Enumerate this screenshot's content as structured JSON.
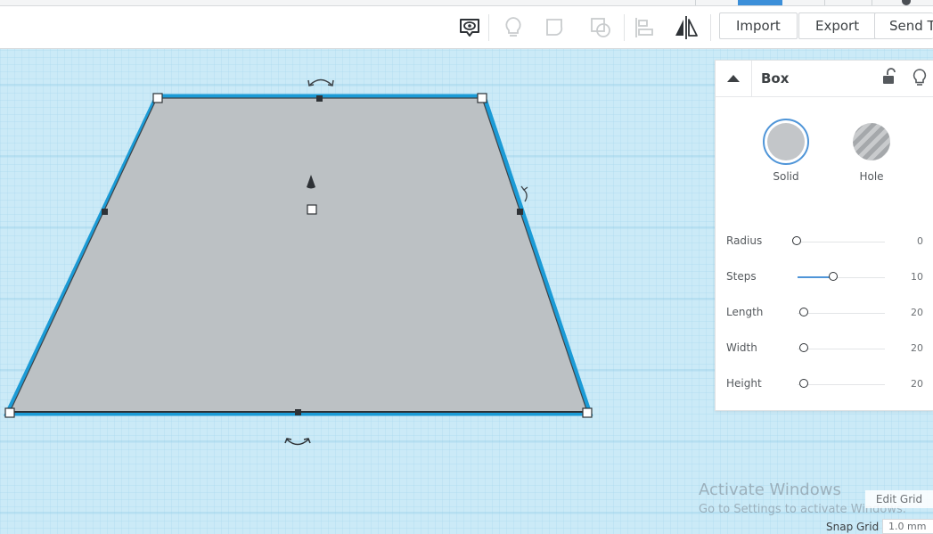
{
  "toolbar": {
    "import_label": "Import",
    "export_label": "Export",
    "send_to_label": "Send To",
    "icons": [
      "notes-toggle-icon",
      "lightbulb-icon",
      "group-icon",
      "ungroup-icon",
      "align-icon",
      "mirror-icon"
    ]
  },
  "inspector": {
    "title": "Box",
    "materials": [
      {
        "label": "Solid",
        "selected": true
      },
      {
        "label": "Hole",
        "selected": false
      }
    ],
    "params": [
      {
        "name": "Radius",
        "value": "0",
        "fraction": 0.0
      },
      {
        "name": "Steps",
        "value": "10",
        "fraction": 0.4
      },
      {
        "name": "Length",
        "value": "20",
        "fraction": 0.08
      },
      {
        "name": "Width",
        "value": "20",
        "fraction": 0.08
      },
      {
        "name": "Height",
        "value": "20",
        "fraction": 0.08
      }
    ]
  },
  "workplane": {
    "shape_color": "#bfc3c6",
    "selection_color": "#1b9bd6",
    "grid_color": "#9fd3ec",
    "plane_color": "#cbeaf7"
  },
  "grid_controls": {
    "edit_grid_label": "Edit Grid",
    "snap_grid_label": "Snap Grid",
    "snap_grid_value": "1.0 mm"
  },
  "watermark": {
    "line1": "Activate Windows",
    "line2": "Go to Settings to activate Windows."
  },
  "colors": {
    "accent": "#4f95d8"
  }
}
